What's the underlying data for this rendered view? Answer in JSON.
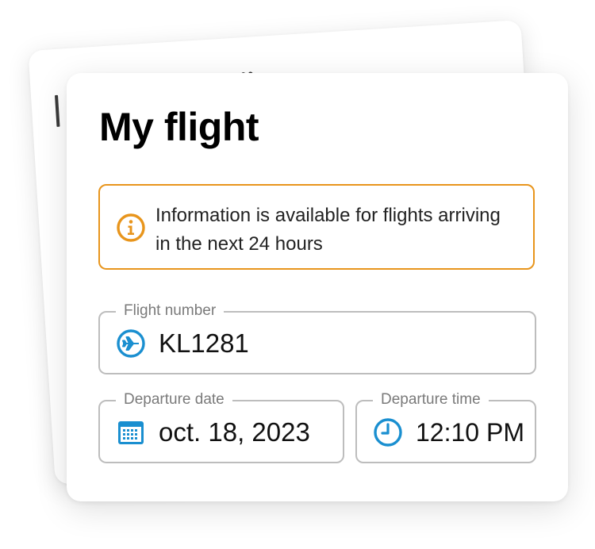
{
  "card": {
    "title": "My flight"
  },
  "info": {
    "icon": "info-icon",
    "message": "Information is available for flights arriving in the next 24 hours",
    "accent_color": "#e8951c"
  },
  "form": {
    "flight_number": {
      "label": "Flight number",
      "value": "KL1281",
      "icon": "airplane-icon"
    },
    "departure_date": {
      "label": "Departure date",
      "value": "oct. 18, 2023",
      "icon": "calendar-icon"
    },
    "departure_time": {
      "label": "Departure time",
      "value": "12:10 PM",
      "icon": "clock-icon"
    }
  },
  "colors": {
    "icon_blue": "#1a8fd0",
    "field_border": "#bdbdbd",
    "label_gray": "#7a7a7a"
  }
}
